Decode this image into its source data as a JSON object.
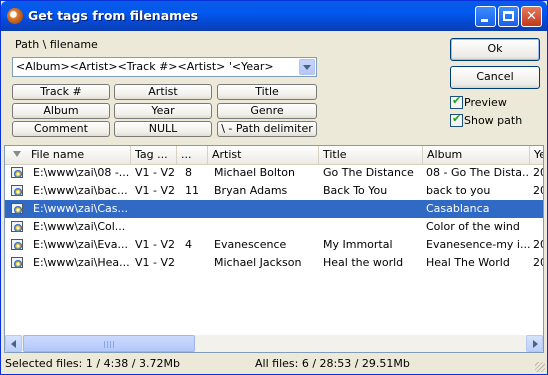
{
  "window": {
    "title": "Get tags from filenames"
  },
  "path_label": "Path \\ filename",
  "pattern_value": "<Album><Artist><Track #><Artist> '<Year>",
  "tag_buttons": [
    [
      "Track #",
      "Artist",
      "Title"
    ],
    [
      "Album",
      "Year",
      "Genre"
    ],
    [
      "Comment",
      "NULL",
      "\\ - Path delimiter"
    ]
  ],
  "actions": {
    "ok": "Ok",
    "cancel": "Cancel"
  },
  "options": [
    {
      "label": "Preview",
      "checked": true
    },
    {
      "label": "Show path",
      "checked": true
    }
  ],
  "columns": [
    "File name",
    "Tag ...",
    "...",
    "Artist",
    "Title",
    "Album",
    "Ye"
  ],
  "rows": [
    [
      "E:\\www\\zai\\08 -...",
      "V1 - V2",
      "8",
      "Michael Bolton",
      "Go The Distance",
      "08 - Go The Dista...",
      "20"
    ],
    [
      "E:\\www\\zai\\bac...",
      "V1 - V2",
      "11",
      "Bryan Adams",
      "Back To You",
      "back to you",
      "20"
    ],
    [
      "E:\\www\\zai\\Cas...",
      "",
      "",
      "",
      "",
      "Casablanca",
      ""
    ],
    [
      "E:\\www\\zai\\Col...",
      "",
      "",
      "",
      "",
      "Color of the wind",
      ""
    ],
    [
      "E:\\www\\zai\\Eva...",
      "V1 - V2",
      "4",
      "Evanescence",
      "My Immortal",
      "Evanesence-my i...",
      "20"
    ],
    [
      "E:\\www\\zai\\Hea...",
      "V1 - V2",
      "",
      "Michael Jackson",
      "Heal the world",
      "Heal The World",
      "20"
    ]
  ],
  "selected_row": 2,
  "status": {
    "selected": "Selected files:  1 / 4:38 / 3.72Mb",
    "all": "All files:  6 / 28:53 / 29.51Mb"
  }
}
